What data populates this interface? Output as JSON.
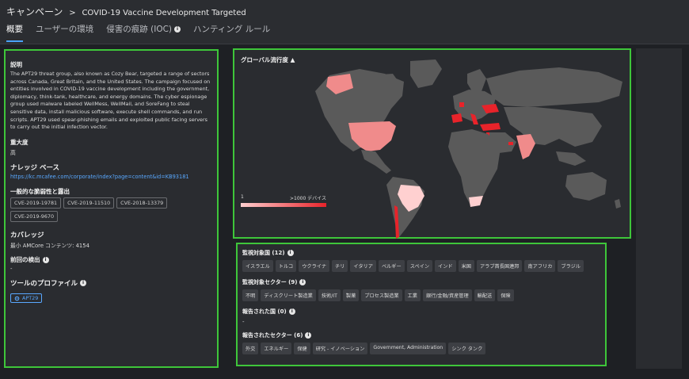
{
  "breadcrumb": {
    "root": "キャンペーン",
    "separator": ">",
    "campaign": "COVID-19 Vaccine Development Targeted"
  },
  "tabs": [
    {
      "label": "概要",
      "active": true
    },
    {
      "label": "ユーザーの環境",
      "active": false
    },
    {
      "label": "侵害の痕跡 (IOC)",
      "active": false,
      "info": true
    },
    {
      "label": "ハンティング ルール",
      "active": false
    }
  ],
  "left": {
    "description_title": "説明",
    "description": "The APT29 threat group, also known as Cozy Bear, targeted a range of sectors across Canada, Great Britain, and the United States. The campaign focused on entities involved in COVID-19 vaccine development including the government, diplomacy, think-tank, healthcare, and energy domains. The cyber espionage group used malware labeled WellMess, WellMail, and SoreFang to steal sensitive data, install malicious software, execute shell commands, and run scripts. APT29 used spear-phishing emails and exploited public facing servers to carry out the initial infection vector.",
    "severity_title": "重大度",
    "severity": "高",
    "kb_title": "ナレッジ ベース",
    "kb_link": "https://kc.mcafee.com/corporate/index?page=content&id=KB93181",
    "cve_title": "一般的な脆弱性と露出",
    "cves": [
      "CVE-2019-19781",
      "CVE-2019-11510",
      "CVE-2018-13379",
      "CVE-2019-9670"
    ],
    "coverage_title": "カバレッジ",
    "coverage": "最小 AMCore コンテンツ: 4154",
    "last_detect_title": "前回の検出",
    "last_detect": "-",
    "tool_title": "ツールのプロファイル",
    "tool": "APT29"
  },
  "map": {
    "title": "グローバル流行度",
    "title_icon": "▲",
    "legend_min": "1",
    "legend_max": ">1000 デバイス",
    "colors": {
      "land": "#5a5a5a",
      "low": "#ffd0d0",
      "mid": "#f08b8b",
      "high": "#e8232a"
    }
  },
  "bottom": {
    "monitored_countries_title": "監視対象国 (12)",
    "monitored_countries": [
      "イスラエル",
      "トルコ",
      "ウクライナ",
      "チリ",
      "イタリア",
      "ベルギー",
      "スペイン",
      "インド",
      "米国",
      "アラブ首長国連邦",
      "南アフリカ",
      "ブラジル"
    ],
    "monitored_sectors_title": "監視対象セクター (9)",
    "monitored_sectors": [
      "不明",
      "ディスクリート製造業",
      "技術/IT",
      "製薬",
      "プロセス製造業",
      "工業",
      "銀行/金融/資産管理",
      "輸配送",
      "保険"
    ],
    "reported_countries_title": "報告された国 (0)",
    "reported_countries_empty": "-",
    "reported_sectors_title": "報告されたセクター (6)",
    "reported_sectors": [
      "外交",
      "エネルギー",
      "保健",
      "研究 - イノベーション",
      "Government, Administration",
      "シンク タンク"
    ]
  }
}
